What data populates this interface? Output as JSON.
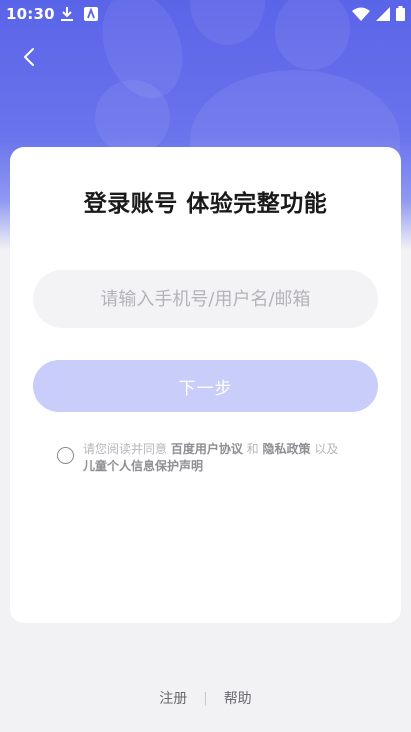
{
  "status_bar": {
    "time": "10:30",
    "left_icons": [
      "download-icon",
      "app-notification-icon"
    ],
    "right_icons": [
      "wifi-icon",
      "signal-icon",
      "battery-icon"
    ]
  },
  "header": {
    "back_icon": "chevron-left-icon",
    "background_color": "#5a64e8"
  },
  "login_card": {
    "title": "登录账号 体验完整功能",
    "account_input": {
      "placeholder": "请输入手机号/用户名/邮箱",
      "value": ""
    },
    "next_button": {
      "label": "下一步",
      "enabled": false,
      "color": "#c9cdf9"
    },
    "agreement": {
      "checked": false,
      "prefix": "请您阅读并同意 ",
      "link_user_agreement": "百度用户协议",
      "and": " 和 ",
      "link_privacy": "隐私政策",
      "and2": " 以及",
      "link_children": "儿童个人信息保护声明"
    }
  },
  "footer": {
    "register": "注册",
    "separator": "|",
    "help": "帮助"
  }
}
